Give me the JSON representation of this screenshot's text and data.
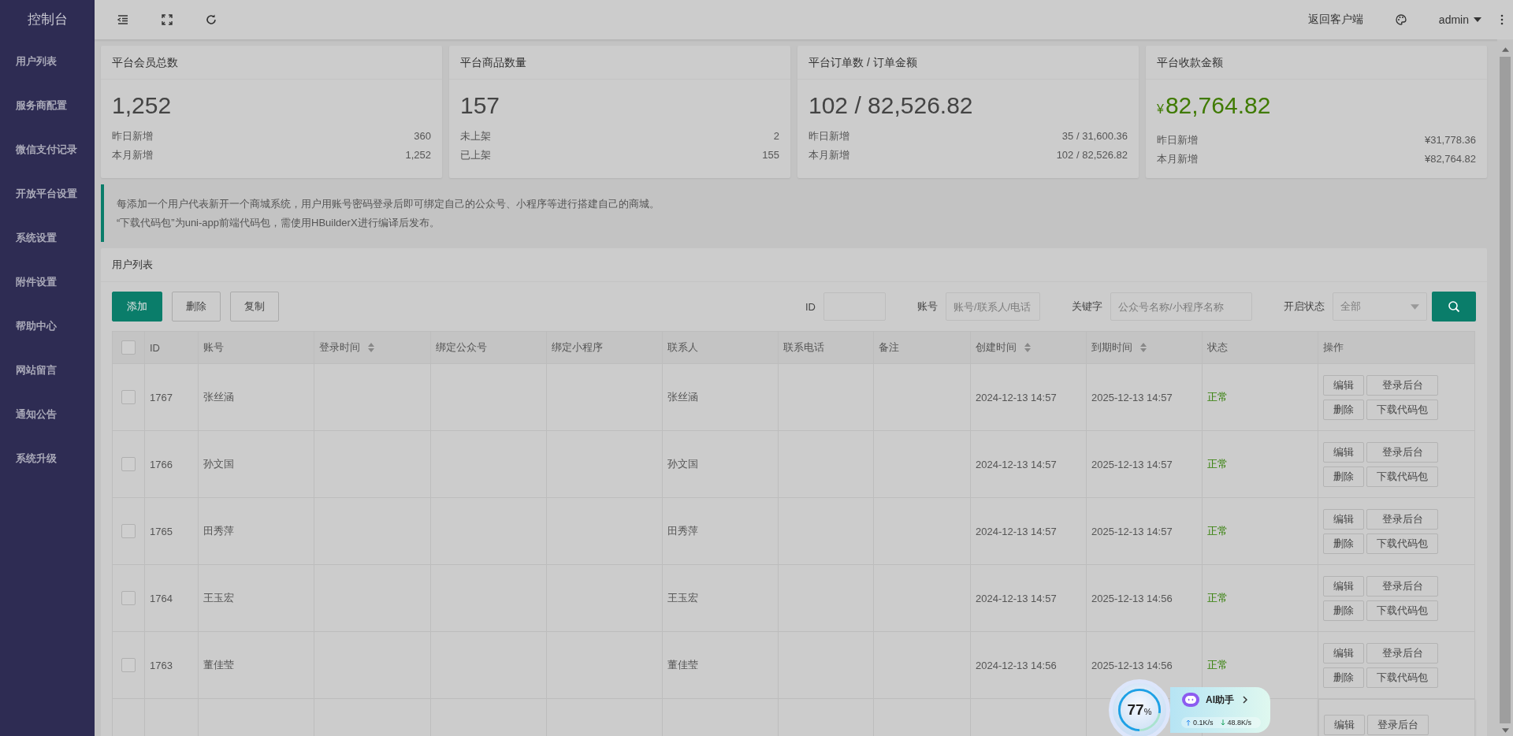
{
  "sidebar": {
    "title": "控制台",
    "items": [
      {
        "label": "用户列表"
      },
      {
        "label": "服务商配置"
      },
      {
        "label": "微信支付记录"
      },
      {
        "label": "开放平台设置"
      },
      {
        "label": "系统设置"
      },
      {
        "label": "附件设置"
      },
      {
        "label": "帮助中心"
      },
      {
        "label": "网站留言"
      },
      {
        "label": "通知公告"
      },
      {
        "label": "系统升级"
      }
    ]
  },
  "topbar": {
    "client_link": "返回客户端",
    "user": "admin"
  },
  "cards": [
    {
      "kind": "plain",
      "title": "平台会员总数",
      "value": "1,252",
      "rows": [
        {
          "label": "昨日新增",
          "value": "360"
        },
        {
          "label": "本月新增",
          "value": "1,252"
        }
      ]
    },
    {
      "kind": "plain",
      "title": "平台商品数量",
      "value": "157",
      "rows": [
        {
          "label": "未上架",
          "value": "2"
        },
        {
          "label": "已上架",
          "value": "155"
        }
      ]
    },
    {
      "kind": "plain",
      "title": "平台订单数 / 订单金额",
      "value": "102 / 82,526.82",
      "rows": [
        {
          "label": "昨日新增",
          "value": "35 / 31,600.36"
        },
        {
          "label": "本月新增",
          "value": "102 / 82,526.82"
        }
      ]
    },
    {
      "kind": "money",
      "prefix": "¥",
      "title": "平台收款金额",
      "value": "82,764.82",
      "rows": [
        {
          "label": "昨日新增",
          "value": "¥31,778.36"
        },
        {
          "label": "本月新增",
          "value": "¥82,764.82"
        }
      ]
    }
  ],
  "notice": [
    "每添加一个用户代表新开一个商城系统，用户用账号密码登录后即可绑定自己的公众号、小程序等进行搭建自己的商城。",
    "“下载代码包”为uni-app前端代码包，需使用HBuilderX进行编译后发布。"
  ],
  "panel": {
    "title": "用户列表",
    "buttons": [
      {
        "label": "添加",
        "kind": "primary"
      },
      {
        "label": "删除",
        "kind": "default"
      },
      {
        "label": "复制",
        "kind": "default"
      }
    ],
    "filters": [
      {
        "label": "ID",
        "kind": "input"
      },
      {
        "label": "账号",
        "kind": "input",
        "placeholder": "账号/联系人/电话"
      },
      {
        "label": "关键字",
        "kind": "input",
        "placeholder": "公众号名称/小程序名称"
      },
      {
        "label": "开启状态",
        "kind": "select",
        "placeholder": "全部"
      }
    ]
  },
  "table": {
    "all_checked": false,
    "columns": [
      {
        "label": "ID",
        "sortable": false
      },
      {
        "label": "账号",
        "sortable": false
      },
      {
        "label": "登录时间",
        "sortable": true
      },
      {
        "label": "绑定公众号",
        "sortable": false
      },
      {
        "label": "绑定小程序",
        "sortable": false
      },
      {
        "label": "联系人",
        "sortable": false
      },
      {
        "label": "联系电话",
        "sortable": false
      },
      {
        "label": "备注",
        "sortable": false
      },
      {
        "label": "创建时间",
        "sortable": true
      },
      {
        "label": "到期时间",
        "sortable": true
      },
      {
        "label": "状态",
        "sortable": false
      },
      {
        "label": "操作",
        "sortable": false
      }
    ],
    "rows": [
      {
        "checked": false,
        "id": "1767",
        "account": "张丝涵",
        "contact": "张丝涵",
        "created": "2024-12-13 14:57",
        "expires": "2025-12-13 14:57",
        "status": "正常",
        "actions": [
          "编辑",
          "登录后台",
          "删除",
          "下载代码包"
        ]
      },
      {
        "checked": false,
        "id": "1766",
        "account": "孙文国",
        "contact": "孙文国",
        "created": "2024-12-13 14:57",
        "expires": "2025-12-13 14:57",
        "status": "正常",
        "actions": [
          "编辑",
          "登录后台",
          "删除",
          "下载代码包"
        ]
      },
      {
        "checked": false,
        "id": "1765",
        "account": "田秀萍",
        "contact": "田秀萍",
        "created": "2024-12-13 14:57",
        "expires": "2025-12-13 14:57",
        "status": "正常",
        "actions": [
          "编辑",
          "登录后台",
          "删除",
          "下载代码包"
        ]
      },
      {
        "checked": false,
        "id": "1764",
        "account": "王玉宏",
        "contact": "王玉宏",
        "created": "2024-12-13 14:57",
        "expires": "2025-12-13 14:56",
        "status": "正常",
        "actions": [
          "编辑",
          "登录后台",
          "删除",
          "下载代码包"
        ]
      },
      {
        "checked": false,
        "id": "1763",
        "account": "董佳莹",
        "contact": "董佳莹",
        "created": "2024-12-13 14:56",
        "expires": "2025-12-13 14:56",
        "status": "正常",
        "actions": [
          "编辑",
          "登录后台",
          "删除",
          "下载代码包"
        ]
      },
      {
        "actions": [
          "编辑",
          "登录后台"
        ]
      }
    ]
  },
  "ai_widget": {
    "percent": "77",
    "unit": "%",
    "level": 0.77,
    "label": "AI助手",
    "up": "0.1K/s",
    "down": "48.8K/s"
  }
}
